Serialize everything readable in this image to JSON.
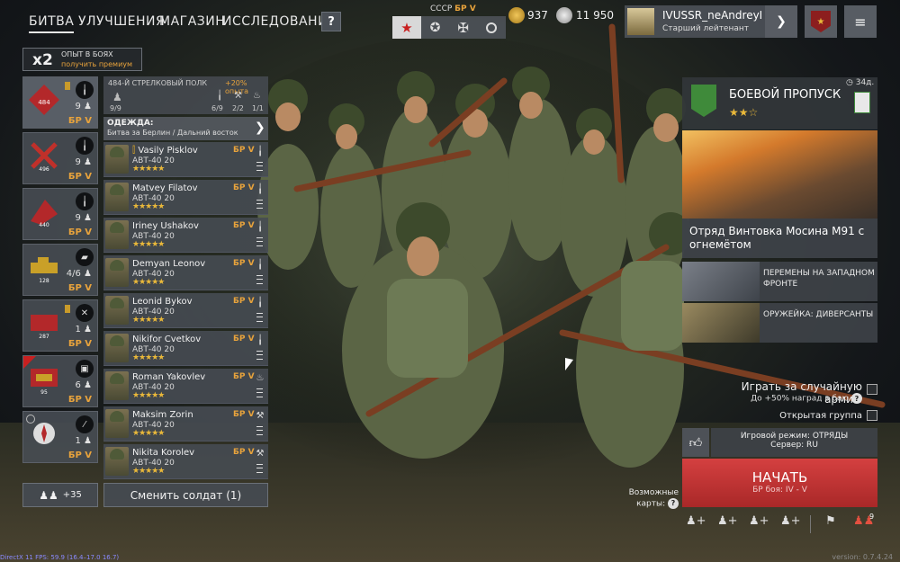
{
  "nav": {
    "tabs": [
      "БИТВА",
      "УЛУЧШЕНИЯ",
      "МАГАЗИН",
      "ИССЛЕДОВАНИЯ"
    ],
    "help": "?"
  },
  "faction": {
    "name": "СССР",
    "br": "БР V"
  },
  "currency": {
    "gold": "937",
    "silver": "11 950"
  },
  "profile": {
    "name": "IVUSSR_neAndreyK",
    "rank": "Старший лейтенант"
  },
  "premium": {
    "multiplier": "x2",
    "line1": "ОПЫТ В БОЯХ",
    "line2": "получить премиум"
  },
  "regiment": {
    "name": "484-Й СТРЕЛКОВЫЙ ПОЛК",
    "bonus": "+20% опыта",
    "slots": "9/9",
    "rifles": "6/9",
    "tools": "2/2",
    "flame": "1/1"
  },
  "clothing": {
    "label": "ОДЕЖДА:",
    "value": "Битва за Берлин / Дальний восток"
  },
  "squads": [
    {
      "number": "484",
      "count": "9",
      "br": "БР V"
    },
    {
      "number": "496",
      "count": "9",
      "br": "БР V"
    },
    {
      "number": "440",
      "count": "9",
      "br": "БР V"
    },
    {
      "number": "128",
      "count": "4/6",
      "br": "БР V"
    },
    {
      "number": "287",
      "count": "1",
      "br": "БР V"
    },
    {
      "number": "95",
      "count": "6",
      "br": "БР V"
    },
    {
      "number": "",
      "count": "1",
      "br": "БР V"
    }
  ],
  "soldiers": [
    {
      "name": "Vasily Pisklov",
      "weapon": "АВТ-40 20",
      "br": "БР V",
      "stars": "★★★★★",
      "icon": "rifle-icon"
    },
    {
      "name": "Matvey Filatov",
      "weapon": "АВТ-40 20",
      "br": "БР V",
      "stars": "★★★★★",
      "icon": "rifle-icon"
    },
    {
      "name": "Iriney Ushakov",
      "weapon": "АВТ-40 20",
      "br": "БР V",
      "stars": "★★★★★",
      "icon": "rifle-icon"
    },
    {
      "name": "Demyan Leonov",
      "weapon": "АВТ-40 20",
      "br": "БР V",
      "stars": "★★★★★",
      "icon": "rifle-icon"
    },
    {
      "name": "Leonid Bykov",
      "weapon": "АВТ-40 20",
      "br": "БР V",
      "stars": "★★★★★",
      "icon": "rifle-icon"
    },
    {
      "name": "Nikifor Cvetkov",
      "weapon": "АВТ-40 20",
      "br": "БР V",
      "stars": "★★★★★",
      "icon": "rifle-icon"
    },
    {
      "name": "Roman Yakovlev",
      "weapon": "АВТ-40 20",
      "br": "БР V",
      "stars": "★★★★★",
      "icon": "flame-icon"
    },
    {
      "name": "Maksim Zorin",
      "weapon": "АВТ-40 20",
      "br": "БР V",
      "stars": "★★★★★",
      "icon": "wrench-icon"
    },
    {
      "name": "Nikita Korolev",
      "weapon": "АВТ-40 20",
      "br": "БР V",
      "stars": "★★★★★",
      "icon": "wrench-icon"
    }
  ],
  "bottom_left": {
    "squad_count": "+35",
    "change_soldier": "Сменить солдат (1)"
  },
  "battle_pass": {
    "timer": "34д.",
    "title": "БОЕВОЙ ПРОПУСК",
    "stars": "★★☆",
    "reward": "Отряд Винтовка Мосина М91 с огнемётом"
  },
  "news": [
    {
      "title": "ПЕРЕМЕНЫ НА ЗАПАДНОМ ФРОНТЕ"
    },
    {
      "title": "ОРУЖЕЙКА: ДИВЕРСАНТЫ"
    }
  ],
  "options": {
    "random_army": "Играть за случайную армию",
    "random_bonus": "До +50% наград в бою",
    "open_group": "Открытая группа"
  },
  "mode": {
    "line1": "Игровой режим: ОТРЯДЫ",
    "line2": "Сервер: RU"
  },
  "start": {
    "label": "НАЧАТЬ",
    "sub": "БР боя: IV - V"
  },
  "maps": {
    "line1": "Возможные",
    "line2": "карты:"
  },
  "group": {
    "count": "9"
  },
  "footer": {
    "fps": "DirectX 11 FPS: 59.9 (16.4–17.0 16.7)",
    "version": "version: 0.7.4.24"
  },
  "colors": {
    "accent": "#e8a33c",
    "start_btn": "#c93636",
    "gold": "#e9b83a",
    "pass_green": "#3f8a3a"
  }
}
